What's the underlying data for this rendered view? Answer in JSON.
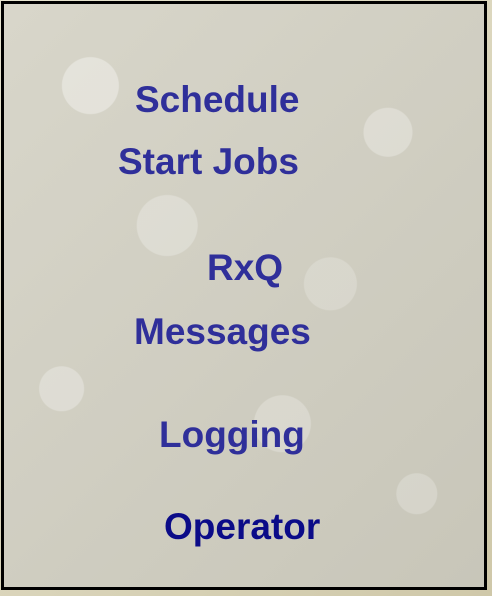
{
  "labels": {
    "schedule": "Schedule",
    "start_jobs": "Start Jobs",
    "rxq": "RxQ",
    "messages": "Messages",
    "logging": "Logging",
    "operator": "Operator"
  }
}
